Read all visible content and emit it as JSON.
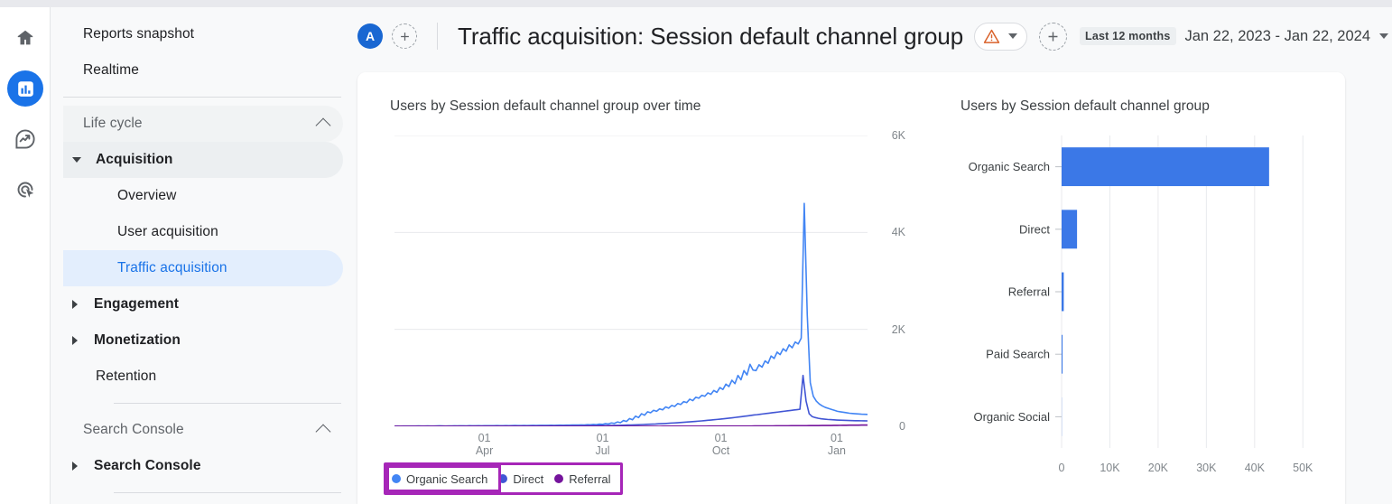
{
  "icon_rail": {
    "items": [
      {
        "name": "home-icon",
        "label": "Home",
        "active": false
      },
      {
        "name": "reports-icon",
        "label": "Reports",
        "active": true
      },
      {
        "name": "explore-icon",
        "label": "Explore",
        "active": false
      },
      {
        "name": "advertising-icon",
        "label": "Advertising",
        "active": false
      }
    ]
  },
  "sidebar": {
    "items": [
      {
        "label": "Reports snapshot"
      },
      {
        "label": "Realtime"
      },
      {
        "label": "Life cycle"
      },
      {
        "label": "Acquisition"
      },
      {
        "label": "Overview"
      },
      {
        "label": "User acquisition"
      },
      {
        "label": "Traffic acquisition"
      },
      {
        "label": "Engagement"
      },
      {
        "label": "Monetization"
      },
      {
        "label": "Retention"
      },
      {
        "label": "Search Console"
      },
      {
        "label": "Search Console"
      }
    ]
  },
  "header": {
    "avatar_letter": "A",
    "add_comparison_label": "+",
    "add_segment_label": "+",
    "title": "Traffic acquisition: Session default channel group",
    "warning_icon": "warning-triangle-icon",
    "date_preset": "Last 12 months",
    "date_range": "Jan 22, 2023 - Jan 22, 2024"
  },
  "colors": {
    "accent_blue": "#1a73e8",
    "bar_blue": "#3b78e7",
    "organic_search": "#4285f4",
    "direct": "#4155d4",
    "referral": "#75149c",
    "highlight_box": "#a626b8"
  },
  "chart_data": [
    {
      "type": "line",
      "title": "Users by Session default channel group over time",
      "xlabel": "",
      "ylabel": "",
      "ylim": [
        0,
        6000
      ],
      "yticks": [
        "0",
        "2K",
        "4K",
        "6K"
      ],
      "ytick_values": [
        0,
        2000,
        4000,
        6000
      ],
      "xticks": [
        {
          "day": "01",
          "month": "Apr"
        },
        {
          "day": "01",
          "month": "Jul"
        },
        {
          "day": "01",
          "month": "Oct"
        },
        {
          "day": "01",
          "month": "Jan"
        }
      ],
      "grid": true,
      "legend_position": "bottom",
      "legend": [
        {
          "name": "Organic Search",
          "color": "#4285f4",
          "highlighted": true
        },
        {
          "name": "Direct",
          "color": "#4155d4",
          "highlighted": false
        },
        {
          "name": "Referral",
          "color": "#75149c",
          "highlighted": false
        }
      ],
      "series": [
        {
          "name": "Organic Search",
          "color": "#4285f4",
          "values": [
            4,
            5,
            4,
            6,
            5,
            7,
            6,
            5,
            8,
            6,
            7,
            9,
            7,
            6,
            8,
            10,
            8,
            7,
            9,
            8,
            10,
            9,
            11,
            10,
            9,
            12,
            10,
            11,
            13,
            11,
            12,
            14,
            12,
            13,
            15,
            13,
            14,
            16,
            14,
            15,
            17,
            15,
            16,
            18,
            16,
            17,
            19,
            18,
            20,
            19,
            21,
            20,
            22,
            21,
            23,
            24,
            22,
            25,
            24,
            26,
            28,
            26,
            30,
            28,
            34,
            31,
            38,
            35,
            45,
            40,
            55,
            48,
            70,
            60,
            90,
            75,
            120,
            100,
            160,
            135,
            210,
            180,
            260,
            230,
            300,
            280,
            330,
            310,
            360,
            340,
            400,
            375,
            430,
            410,
            470,
            450,
            510,
            490,
            560,
            530,
            600,
            580,
            640,
            620,
            690,
            660,
            740,
            700,
            800,
            760,
            870,
            820,
            950,
            880,
            1050,
            960,
            1150,
            1060,
            1280,
            1160,
            1150,
            1270,
            1220,
            1350,
            1300,
            1450,
            1400,
            1530,
            1480,
            1600,
            1550,
            1680,
            1620,
            1740,
            1700,
            1820,
            4600,
            2300,
            900,
            620,
            520,
            460,
            420,
            390,
            370,
            350,
            330,
            310,
            300,
            290,
            280,
            270,
            265,
            260,
            255,
            250,
            248,
            245
          ]
        },
        {
          "name": "Direct",
          "color": "#4155d4",
          "values": [
            2,
            2,
            3,
            2,
            3,
            2,
            3,
            3,
            2,
            3,
            3,
            4,
            3,
            3,
            4,
            3,
            4,
            4,
            3,
            4,
            4,
            5,
            4,
            4,
            5,
            4,
            5,
            5,
            4,
            5,
            5,
            6,
            5,
            5,
            6,
            5,
            6,
            6,
            5,
            6,
            6,
            7,
            6,
            6,
            7,
            6,
            7,
            7,
            8,
            7,
            8,
            8,
            9,
            8,
            9,
            9,
            10,
            9,
            10,
            10,
            11,
            11,
            12,
            12,
            13,
            13,
            14,
            15,
            16,
            16,
            18,
            18,
            20,
            21,
            23,
            24,
            26,
            28,
            30,
            32,
            35,
            37,
            40,
            43,
            46,
            48,
            52,
            55,
            58,
            62,
            66,
            70,
            74,
            78,
            83,
            87,
            92,
            97,
            102,
            107,
            112,
            118,
            124,
            130,
            136,
            142,
            148,
            155,
            162,
            169,
            176,
            184,
            192,
            200,
            208,
            216,
            225,
            234,
            240,
            248,
            256,
            264,
            272,
            280,
            288,
            296,
            304,
            312,
            320,
            328,
            336,
            344,
            352,
            1050,
            520,
            260,
            200,
            180,
            165,
            155,
            148,
            142,
            138,
            134,
            130,
            127,
            124,
            122,
            120,
            118,
            116,
            115,
            114,
            113,
            112
          ]
        },
        {
          "name": "Referral",
          "color": "#75149c",
          "values": [
            1,
            1,
            1,
            1,
            1,
            1,
            1,
            1,
            1,
            1,
            1,
            1,
            1,
            1,
            1,
            1,
            1,
            1,
            1,
            1,
            1,
            1,
            1,
            1,
            1,
            1,
            1,
            1,
            1,
            1,
            1,
            1,
            1,
            1,
            1,
            1,
            1,
            1,
            1,
            1,
            1,
            1,
            1,
            1,
            1,
            1,
            1,
            1,
            1,
            1,
            1,
            1,
            1,
            1,
            1,
            1,
            1,
            1,
            1,
            1,
            1,
            1,
            1,
            1,
            1,
            1,
            1,
            1,
            1,
            1,
            1,
            1,
            1,
            1,
            1,
            1,
            1,
            1,
            2,
            2,
            2,
            2,
            2,
            2,
            2,
            2,
            2,
            2,
            3,
            3,
            3,
            3,
            3,
            3,
            3,
            3,
            4,
            4,
            4,
            4,
            4,
            4,
            4,
            5,
            5,
            5,
            5,
            5,
            5,
            6,
            6,
            6,
            6,
            6,
            7,
            7,
            7,
            7,
            8,
            8,
            8,
            8,
            9,
            9,
            9,
            10,
            10,
            10,
            11,
            11,
            12,
            12,
            13,
            13,
            14,
            14,
            15,
            15,
            16,
            16,
            17,
            17,
            18,
            18,
            19,
            20,
            21,
            22,
            23,
            24,
            24,
            25,
            25,
            26,
            26,
            27
          ]
        }
      ]
    },
    {
      "type": "bar",
      "orientation": "horizontal",
      "title": "Users by Session default channel group",
      "xlabel": "",
      "ylabel": "",
      "xlim": [
        0,
        55000
      ],
      "xticks": [
        "0",
        "10K",
        "20K",
        "30K",
        "40K",
        "50K"
      ],
      "xtick_values": [
        0,
        10000,
        20000,
        30000,
        40000,
        50000
      ],
      "grid": true,
      "bar_color": "#3b78e7",
      "categories": [
        "Organic Search",
        "Direct",
        "Referral",
        "Paid Search",
        "Organic Social"
      ],
      "values": [
        43000,
        3200,
        450,
        200,
        30
      ]
    }
  ]
}
